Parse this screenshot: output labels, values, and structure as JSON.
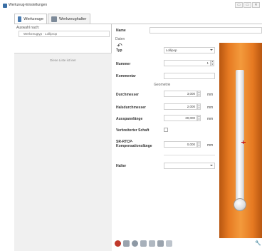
{
  "window": {
    "title": "Werkzeug-Einstellungen",
    "buttons": [
      "▭",
      "▭",
      "✕"
    ]
  },
  "tabs": [
    {
      "label": "Werkzeuge",
      "active": true,
      "icon": "tools-icon"
    },
    {
      "label": "Werkzeughalter",
      "active": false,
      "icon": "holder-icon"
    }
  ],
  "sidebar": {
    "sort_label": "Auswahl nach:",
    "sort_value": "Werkzeugtyp · Lolliprop",
    "undo_icon": "↶",
    "empty_text": "Diese Liste ist leer"
  },
  "form": {
    "name_label": "Name",
    "name_value": "",
    "section_data": "Daten",
    "type_label": "Typ",
    "type_value": "Lollipop",
    "number_label": "Nummer",
    "number_value": "1",
    "comment_label": "Kommentar",
    "comment_value": "",
    "section_geometry": "Geometrie",
    "diameter_label": "Durchmesser",
    "diameter_value": "3,000",
    "neck_label": "Halsdurchmesser",
    "neck_value": "2,000",
    "length_label": "Ausspannlänge",
    "length_value": "30,000",
    "unit": "mm",
    "extended_shaft_label": "Verbreiterter Schaft",
    "extended_shaft_checked": false,
    "rtcp_label": "SR-RTCP-Kompensationslänge",
    "rtcp_value": "0,000",
    "holder_label": "Halter",
    "holder_value": ""
  },
  "toolbar": {
    "icons": [
      "add-icon",
      "copy-icon",
      "save-icon",
      "import-icon",
      "export-icon",
      "print-icon",
      "group-icon"
    ],
    "corner": "🔧"
  },
  "colors": {
    "preview_orange": "#e67a22",
    "tab_border": "#c9c9c9"
  }
}
